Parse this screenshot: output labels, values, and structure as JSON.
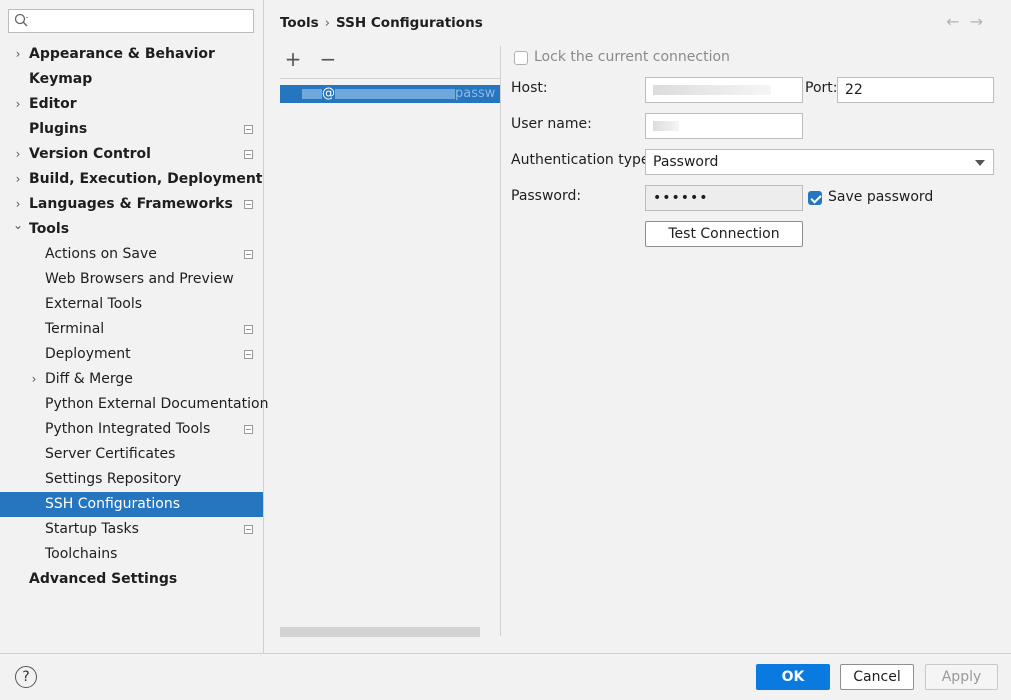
{
  "sidebar": {
    "search": {
      "value": "",
      "placeholder": ""
    },
    "items": [
      {
        "label": "Appearance & Behavior",
        "level": 0,
        "bold": true,
        "expander": "collapsed",
        "project": false
      },
      {
        "label": "Keymap",
        "level": 0,
        "bold": true,
        "expander": "none",
        "project": false
      },
      {
        "label": "Editor",
        "level": 0,
        "bold": true,
        "expander": "collapsed",
        "project": false
      },
      {
        "label": "Plugins",
        "level": 0,
        "bold": true,
        "expander": "none",
        "project": true
      },
      {
        "label": "Version Control",
        "level": 0,
        "bold": true,
        "expander": "collapsed",
        "project": true
      },
      {
        "label": "Build, Execution, Deployment",
        "level": 0,
        "bold": true,
        "expander": "collapsed",
        "project": false
      },
      {
        "label": "Languages & Frameworks",
        "level": 0,
        "bold": true,
        "expander": "collapsed",
        "project": true
      },
      {
        "label": "Tools",
        "level": 0,
        "bold": true,
        "expander": "expanded",
        "project": false
      },
      {
        "label": "Actions on Save",
        "level": 1,
        "bold": false,
        "expander": "none",
        "project": true
      },
      {
        "label": "Web Browsers and Preview",
        "level": 1,
        "bold": false,
        "expander": "none",
        "project": false
      },
      {
        "label": "External Tools",
        "level": 1,
        "bold": false,
        "expander": "none",
        "project": false
      },
      {
        "label": "Terminal",
        "level": 1,
        "bold": false,
        "expander": "none",
        "project": true
      },
      {
        "label": "Deployment",
        "level": 1,
        "bold": false,
        "expander": "none",
        "project": true
      },
      {
        "label": "Diff & Merge",
        "level": 1,
        "bold": false,
        "expander": "collapsed",
        "project": false
      },
      {
        "label": "Python External Documentation",
        "level": 1,
        "bold": false,
        "expander": "none",
        "project": false
      },
      {
        "label": "Python Integrated Tools",
        "level": 1,
        "bold": false,
        "expander": "none",
        "project": true
      },
      {
        "label": "Server Certificates",
        "level": 1,
        "bold": false,
        "expander": "none",
        "project": false
      },
      {
        "label": "Settings Repository",
        "level": 1,
        "bold": false,
        "expander": "none",
        "project": false
      },
      {
        "label": "SSH Configurations",
        "level": 1,
        "bold": false,
        "expander": "none",
        "project": false,
        "selected": true
      },
      {
        "label": "Startup Tasks",
        "level": 1,
        "bold": false,
        "expander": "none",
        "project": true
      },
      {
        "label": "Toolchains",
        "level": 1,
        "bold": false,
        "expander": "none",
        "project": false
      },
      {
        "label": "Advanced Settings",
        "level": 0,
        "bold": true,
        "expander": "none",
        "project": false
      }
    ]
  },
  "breadcrumb": {
    "parent": "Tools",
    "separator": "›",
    "current": "SSH Configurations"
  },
  "nav": {
    "back": "←",
    "forward": "→"
  },
  "toolbar": {
    "add": "+",
    "remove": "−"
  },
  "list": {
    "selected_entry": {
      "at_sign": "@",
      "tail": "passw"
    }
  },
  "form": {
    "lock": {
      "label": "Lock the current connection",
      "checked": false
    },
    "host": {
      "label": "Host:",
      "value": ""
    },
    "port": {
      "label": "Port:",
      "value": "22"
    },
    "username": {
      "label": "User name:",
      "value": ""
    },
    "auth": {
      "label": "Authentication type:",
      "value": "Password"
    },
    "password": {
      "label": "Password:",
      "value": "••••••"
    },
    "save_password": {
      "label": "Save password",
      "checked": true
    },
    "test_button": "Test Connection"
  },
  "footer": {
    "help": "?",
    "ok": "OK",
    "cancel": "Cancel",
    "apply": "Apply"
  },
  "colors": {
    "accent": "#2675bf",
    "primary_button": "#0a7ae0",
    "background": "#f2f2f2"
  }
}
